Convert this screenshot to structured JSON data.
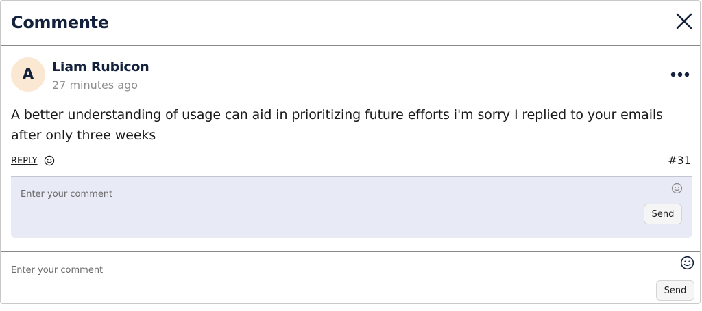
{
  "header": {
    "title": "Commente",
    "close_icon": "close-icon"
  },
  "comment": {
    "avatar_initial": "A",
    "author": "Liam Rubicon",
    "time": "27 minutes ago",
    "more_icon": "more-horizontal-icon",
    "text": "A better understanding of usage can aid in prioritizing future efforts i'm sorry I replied to your emails after only three weeks",
    "reply_label": "REPLY",
    "reaction_icon": "smiley-icon",
    "number": "#31"
  },
  "reply_box": {
    "placeholder": "Enter your comment",
    "value": "",
    "emoji_icon": "smiley-icon",
    "send_label": "Send"
  },
  "footer": {
    "placeholder": "Enter your comment",
    "value": "",
    "emoji_icon": "smiley-icon",
    "send_label": "Send"
  },
  "colors": {
    "title": "#14213d",
    "avatar_bg": "#fbe8d3",
    "reply_box_bg": "#e8ebf5",
    "muted_text": "#8d8d8d"
  }
}
